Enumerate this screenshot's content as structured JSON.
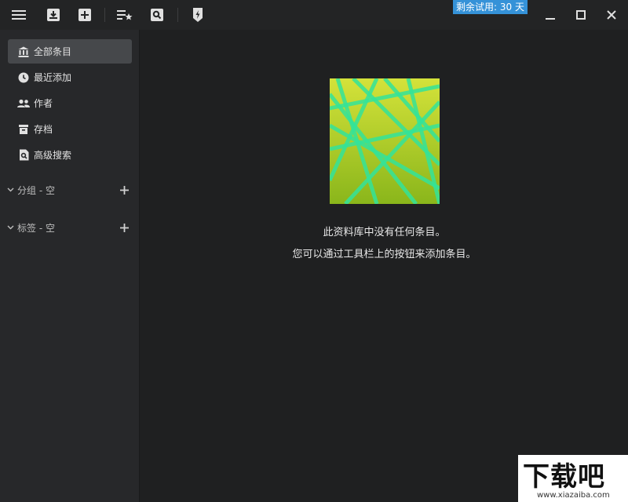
{
  "toolbar": {
    "trial_badge": "剩余试用: 30 天",
    "icons": [
      "menu-icon",
      "import-icon",
      "add-icon",
      "reading-list-icon",
      "search-icon",
      "quick-action-icon"
    ]
  },
  "window_controls": [
    "minimize-icon",
    "maximize-icon",
    "close-icon"
  ],
  "sidebar": {
    "items": [
      {
        "label": "全部条目",
        "icon": "library-icon",
        "active": true
      },
      {
        "label": "最近添加",
        "icon": "clock-icon",
        "active": false
      },
      {
        "label": "作者",
        "icon": "people-icon",
        "active": false
      },
      {
        "label": "存档",
        "icon": "archive-icon",
        "active": false
      },
      {
        "label": "高级搜索",
        "icon": "advanced-search-icon",
        "active": false
      }
    ],
    "sections": [
      {
        "label": "分组 - 空"
      },
      {
        "label": "标签 - 空"
      }
    ]
  },
  "main": {
    "empty_line1": "此资料库中没有任何条目。",
    "empty_line2": "您可以通过工具栏上的按钮来添加条目。"
  },
  "watermark": {
    "big": "下载吧",
    "small": "www.xiazaiba.com"
  },
  "colors": {
    "accent": "#3592d8",
    "art_top": "#d4e23a",
    "art_bottom": "#8ab61b",
    "art_lines": "#33e39a"
  }
}
